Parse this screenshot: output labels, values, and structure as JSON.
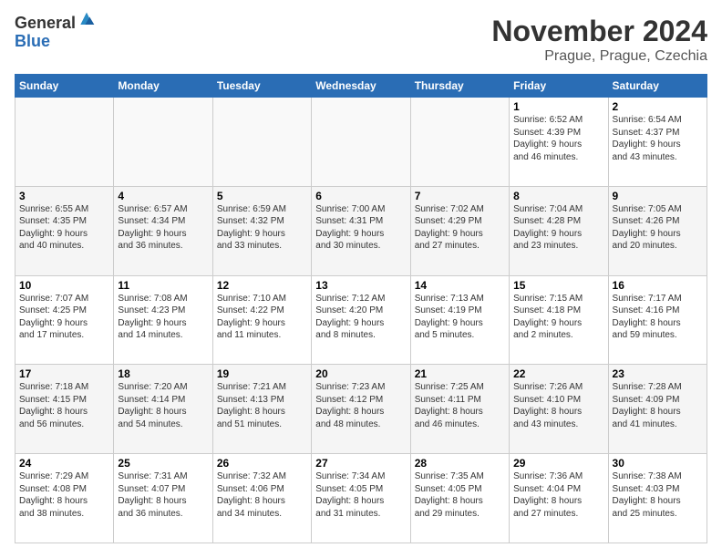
{
  "logo": {
    "general": "General",
    "blue": "Blue"
  },
  "title": "November 2024",
  "location": "Prague, Prague, Czechia",
  "days_header": [
    "Sunday",
    "Monday",
    "Tuesday",
    "Wednesday",
    "Thursday",
    "Friday",
    "Saturday"
  ],
  "weeks": [
    [
      {
        "day": "",
        "info": ""
      },
      {
        "day": "",
        "info": ""
      },
      {
        "day": "",
        "info": ""
      },
      {
        "day": "",
        "info": ""
      },
      {
        "day": "",
        "info": ""
      },
      {
        "day": "1",
        "info": "Sunrise: 6:52 AM\nSunset: 4:39 PM\nDaylight: 9 hours\nand 46 minutes."
      },
      {
        "day": "2",
        "info": "Sunrise: 6:54 AM\nSunset: 4:37 PM\nDaylight: 9 hours\nand 43 minutes."
      }
    ],
    [
      {
        "day": "3",
        "info": "Sunrise: 6:55 AM\nSunset: 4:35 PM\nDaylight: 9 hours\nand 40 minutes."
      },
      {
        "day": "4",
        "info": "Sunrise: 6:57 AM\nSunset: 4:34 PM\nDaylight: 9 hours\nand 36 minutes."
      },
      {
        "day": "5",
        "info": "Sunrise: 6:59 AM\nSunset: 4:32 PM\nDaylight: 9 hours\nand 33 minutes."
      },
      {
        "day": "6",
        "info": "Sunrise: 7:00 AM\nSunset: 4:31 PM\nDaylight: 9 hours\nand 30 minutes."
      },
      {
        "day": "7",
        "info": "Sunrise: 7:02 AM\nSunset: 4:29 PM\nDaylight: 9 hours\nand 27 minutes."
      },
      {
        "day": "8",
        "info": "Sunrise: 7:04 AM\nSunset: 4:28 PM\nDaylight: 9 hours\nand 23 minutes."
      },
      {
        "day": "9",
        "info": "Sunrise: 7:05 AM\nSunset: 4:26 PM\nDaylight: 9 hours\nand 20 minutes."
      }
    ],
    [
      {
        "day": "10",
        "info": "Sunrise: 7:07 AM\nSunset: 4:25 PM\nDaylight: 9 hours\nand 17 minutes."
      },
      {
        "day": "11",
        "info": "Sunrise: 7:08 AM\nSunset: 4:23 PM\nDaylight: 9 hours\nand 14 minutes."
      },
      {
        "day": "12",
        "info": "Sunrise: 7:10 AM\nSunset: 4:22 PM\nDaylight: 9 hours\nand 11 minutes."
      },
      {
        "day": "13",
        "info": "Sunrise: 7:12 AM\nSunset: 4:20 PM\nDaylight: 9 hours\nand 8 minutes."
      },
      {
        "day": "14",
        "info": "Sunrise: 7:13 AM\nSunset: 4:19 PM\nDaylight: 9 hours\nand 5 minutes."
      },
      {
        "day": "15",
        "info": "Sunrise: 7:15 AM\nSunset: 4:18 PM\nDaylight: 9 hours\nand 2 minutes."
      },
      {
        "day": "16",
        "info": "Sunrise: 7:17 AM\nSunset: 4:16 PM\nDaylight: 8 hours\nand 59 minutes."
      }
    ],
    [
      {
        "day": "17",
        "info": "Sunrise: 7:18 AM\nSunset: 4:15 PM\nDaylight: 8 hours\nand 56 minutes."
      },
      {
        "day": "18",
        "info": "Sunrise: 7:20 AM\nSunset: 4:14 PM\nDaylight: 8 hours\nand 54 minutes."
      },
      {
        "day": "19",
        "info": "Sunrise: 7:21 AM\nSunset: 4:13 PM\nDaylight: 8 hours\nand 51 minutes."
      },
      {
        "day": "20",
        "info": "Sunrise: 7:23 AM\nSunset: 4:12 PM\nDaylight: 8 hours\nand 48 minutes."
      },
      {
        "day": "21",
        "info": "Sunrise: 7:25 AM\nSunset: 4:11 PM\nDaylight: 8 hours\nand 46 minutes."
      },
      {
        "day": "22",
        "info": "Sunrise: 7:26 AM\nSunset: 4:10 PM\nDaylight: 8 hours\nand 43 minutes."
      },
      {
        "day": "23",
        "info": "Sunrise: 7:28 AM\nSunset: 4:09 PM\nDaylight: 8 hours\nand 41 minutes."
      }
    ],
    [
      {
        "day": "24",
        "info": "Sunrise: 7:29 AM\nSunset: 4:08 PM\nDaylight: 8 hours\nand 38 minutes."
      },
      {
        "day": "25",
        "info": "Sunrise: 7:31 AM\nSunset: 4:07 PM\nDaylight: 8 hours\nand 36 minutes."
      },
      {
        "day": "26",
        "info": "Sunrise: 7:32 AM\nSunset: 4:06 PM\nDaylight: 8 hours\nand 34 minutes."
      },
      {
        "day": "27",
        "info": "Sunrise: 7:34 AM\nSunset: 4:05 PM\nDaylight: 8 hours\nand 31 minutes."
      },
      {
        "day": "28",
        "info": "Sunrise: 7:35 AM\nSunset: 4:05 PM\nDaylight: 8 hours\nand 29 minutes."
      },
      {
        "day": "29",
        "info": "Sunrise: 7:36 AM\nSunset: 4:04 PM\nDaylight: 8 hours\nand 27 minutes."
      },
      {
        "day": "30",
        "info": "Sunrise: 7:38 AM\nSunset: 4:03 PM\nDaylight: 8 hours\nand 25 minutes."
      }
    ]
  ]
}
